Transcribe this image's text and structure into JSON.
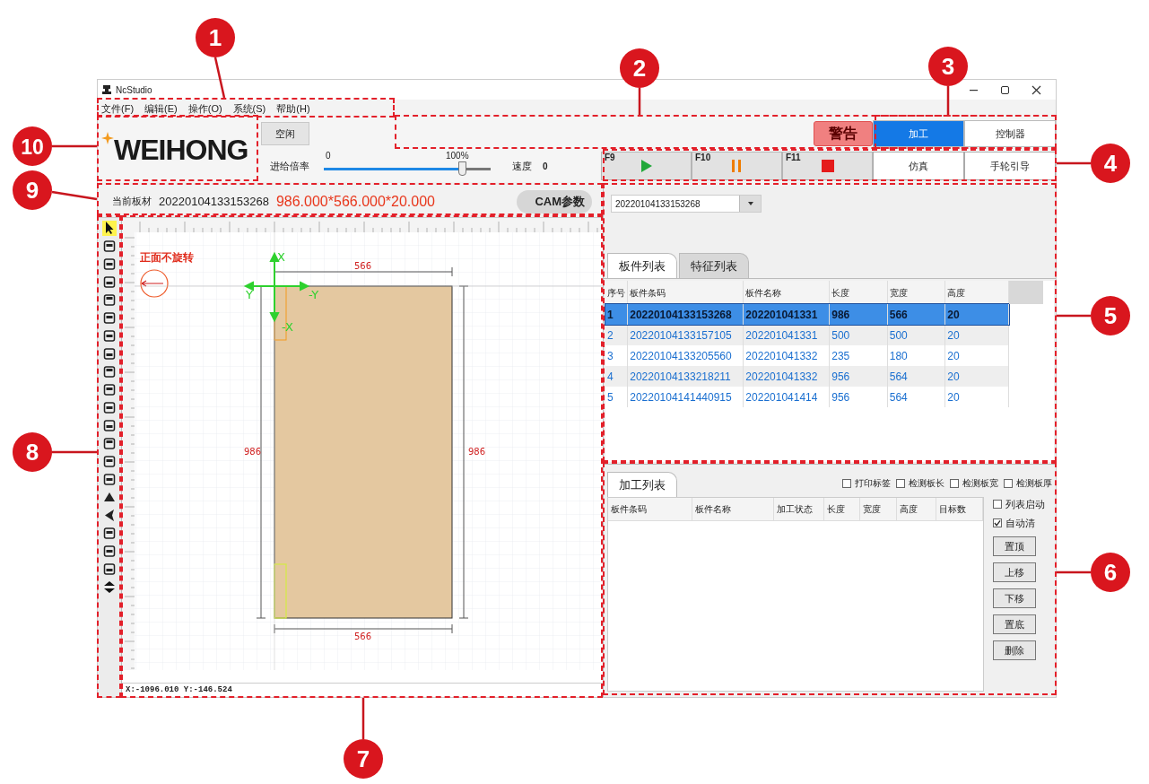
{
  "callouts": [
    "1",
    "3",
    "2",
    "10",
    "4",
    "9",
    "5",
    "8",
    "6",
    "7"
  ],
  "window": {
    "title": "NcStudio"
  },
  "menu": [
    "文件(F)",
    "编辑(E)",
    "操作(O)",
    "系统(S)",
    "帮助(H)"
  ],
  "logo": "WEIHONG",
  "status_button": "空闲",
  "feed": {
    "label": "进给倍率",
    "min": "0",
    "max": "100%",
    "level": 0.83,
    "speed_label": "速度",
    "speed": "0"
  },
  "alarm": "警告",
  "mode_tabs": [
    {
      "label": "加工",
      "selected": true
    },
    {
      "label": "控制器",
      "selected": false
    }
  ],
  "run_buttons": [
    {
      "key": "F9",
      "kind": "start"
    },
    {
      "key": "F10",
      "kind": "pause"
    },
    {
      "key": "F11",
      "kind": "stop"
    }
  ],
  "tool_buttons": [
    "仿真",
    "手轮引导"
  ],
  "board_bar": {
    "label": "当前板材",
    "code": "20220104133153268",
    "size": "986.000*566.000*20.000",
    "cam_button": "CAM参数"
  },
  "canvas": {
    "note": "正面不旋转",
    "axis_labels": [
      "X",
      "-Y",
      "Y",
      "-X"
    ],
    "width_labels": [
      "566",
      "566"
    ],
    "length_labels": [
      "986",
      "986"
    ]
  },
  "coordinates": "X:-1096.010 Y:-146.524",
  "board_select": {
    "value": "20220104133153268"
  },
  "parts_tabs": [
    {
      "label": "板件列表",
      "selected": true
    },
    {
      "label": "特征列表",
      "selected": false
    }
  ],
  "parts_table": {
    "columns": [
      "序号",
      "板件条码",
      "板件名称",
      "长度",
      "宽度",
      "高度"
    ],
    "rows": [
      {
        "cells": [
          "1",
          "20220104133153268",
          "202201041331",
          "986",
          "566",
          "20"
        ],
        "selected": true
      },
      {
        "cells": [
          "2",
          "20220104133157105",
          "202201041331",
          "500",
          "500",
          "20"
        ],
        "selected": false
      },
      {
        "cells": [
          "3",
          "20220104133205560",
          "202201041332",
          "235",
          "180",
          "20"
        ],
        "selected": false
      },
      {
        "cells": [
          "4",
          "20220104133218211",
          "202201041332",
          "956",
          "564",
          "20"
        ],
        "selected": false
      },
      {
        "cells": [
          "5",
          "20220104141440915",
          "202201041414",
          "956",
          "564",
          "20"
        ],
        "selected": false
      }
    ]
  },
  "job_tab": "加工列表",
  "job_options": [
    {
      "label": "打印标签",
      "checked": false
    },
    {
      "label": "检测板长",
      "checked": false
    },
    {
      "label": "检测板宽",
      "checked": false
    },
    {
      "label": "检测板厚",
      "checked": false
    }
  ],
  "job_table": {
    "columns": [
      "板件条码",
      "板件名称",
      "加工状态",
      "长度",
      "宽度",
      "高度",
      "目标数"
    ]
  },
  "job_side_options": [
    {
      "label": "列表启动",
      "checked": false
    },
    {
      "label": "自动清",
      "checked": true
    }
  ],
  "job_buttons": [
    "置顶",
    "上移",
    "下移",
    "置底",
    "删除"
  ]
}
